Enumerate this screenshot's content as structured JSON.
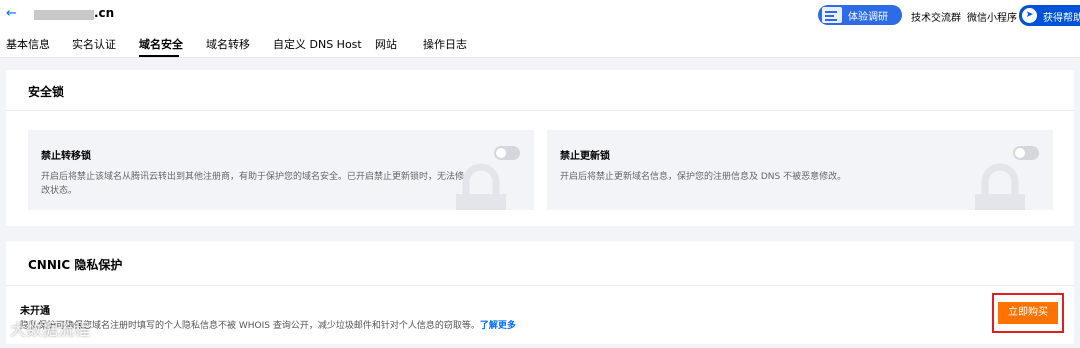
{
  "header": {
    "back_icon": "arrow-left-icon",
    "domain_suffix": ".cn",
    "survey_label": "体验调研",
    "tech_group_label": "技术交流群",
    "miniprogram_label": "微信小程序",
    "help_label": "获得帮助",
    "accent_color": "#0052d9"
  },
  "tabs": [
    {
      "label": "基本信息",
      "active": false
    },
    {
      "label": "实名认证",
      "active": false
    },
    {
      "label": "域名安全",
      "active": true
    },
    {
      "label": "域名转移",
      "active": false
    },
    {
      "label": "自定义 DNS Host",
      "active": false
    },
    {
      "label": "网站",
      "active": false
    },
    {
      "label": "操作日志",
      "active": false
    }
  ],
  "security_lock": {
    "title": "安全锁",
    "cards": [
      {
        "title": "禁止转移锁",
        "desc": "开启后将禁止该域名从腾讯云转出到其他注册商，有助于保护您的域名安全。已开启禁止更新锁时，无法修改状态。",
        "enabled": false
      },
      {
        "title": "禁止更新锁",
        "desc": "开启后将禁止更新域名信息，保护您的注册信息及 DNS 不被恶意修改。",
        "enabled": false
      }
    ]
  },
  "cnnic": {
    "title": "CNNIC 隐私保护",
    "status": "未开通",
    "desc": "隐私保护可确保您域名注册时填写的个人隐私信息不被 WHOIS 查询公开，减少垃圾邮件和针对个人信息的窃取等。",
    "learn_more": "了解更多",
    "buy_label": "立即购买",
    "buy_color": "#ff7200"
  },
  "watermark": "大数据流程"
}
